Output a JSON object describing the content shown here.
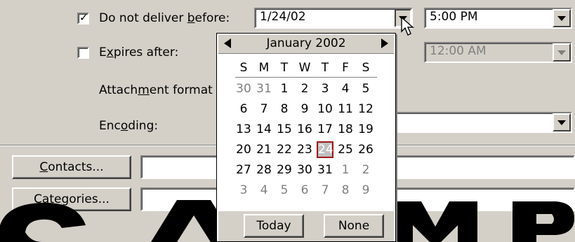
{
  "deliver_before": {
    "checked": true,
    "label_pre": "Do not deliver ",
    "label_ul": "b",
    "label_post": "efore:",
    "date_value": "1/24/02",
    "time_value": "5:00 PM"
  },
  "expires_after": {
    "checked": false,
    "label_pre": "E",
    "label_ul": "x",
    "label_post": "pires after:",
    "time_value": "12:00 AM"
  },
  "attachment_format": {
    "label_pre": "Attach",
    "label_ul": "m",
    "label_post": "ent format"
  },
  "encoding": {
    "label_pre": "Enc",
    "label_ul": "o",
    "label_post": "ding:"
  },
  "contacts_button": {
    "ul": "C",
    "rest": "ontacts..."
  },
  "categories_button": {
    "pre": "Cate",
    "ul": "g",
    "post": "ories..."
  },
  "calendar": {
    "month_title": "January 2002",
    "weekdays": [
      "S",
      "M",
      "T",
      "W",
      "T",
      "F",
      "S"
    ],
    "weeks": [
      [
        "30",
        "31",
        "1",
        "2",
        "3",
        "4",
        "5"
      ],
      [
        "6",
        "7",
        "8",
        "9",
        "10",
        "11",
        "12"
      ],
      [
        "13",
        "14",
        "15",
        "16",
        "17",
        "18",
        "19"
      ],
      [
        "20",
        "21",
        "22",
        "23",
        "24",
        "25",
        "26"
      ],
      [
        "27",
        "28",
        "29",
        "30",
        "31",
        "1",
        "2"
      ],
      [
        "3",
        "4",
        "5",
        "6",
        "7",
        "8",
        "9"
      ]
    ],
    "selected_day": "24",
    "today_button": "Today",
    "none_button": "None"
  },
  "watermark_text": "SAMPLE",
  "colors": {
    "dialog_bg": "#d4d0c8",
    "field_bg": "#ffffff",
    "selected_border": "#a01818",
    "disabled_text": "#808080"
  },
  "icons": [
    "checkmark-icon",
    "chevron-down-icon",
    "triangle-left-icon",
    "triangle-right-icon",
    "mouse-pointer-icon"
  ]
}
